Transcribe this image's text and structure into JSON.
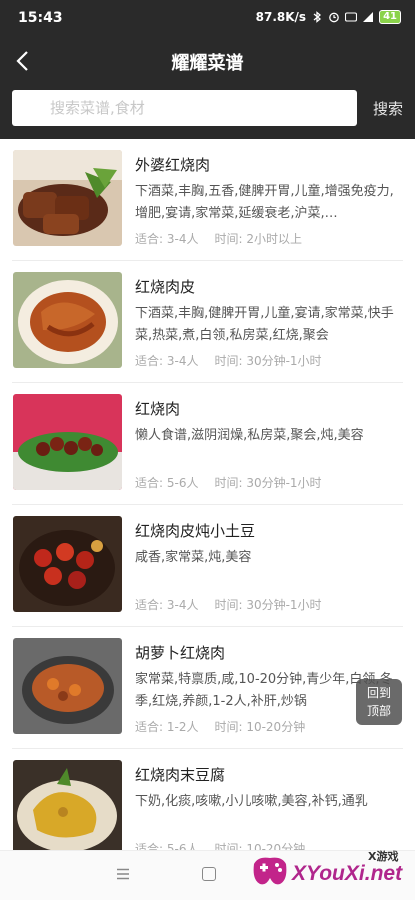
{
  "status_bar": {
    "time": "15:43",
    "network_speed": "87.8K/s",
    "battery": "41"
  },
  "header": {
    "title": "耀耀菜谱",
    "back_icon": "chevron-left-icon"
  },
  "search": {
    "placeholder": "搜索菜谱,食材",
    "button_label": "搜索"
  },
  "recipes": [
    {
      "name": "外婆红烧肉",
      "tags": "下酒菜,丰胸,五香,健脾开胃,儿童,增强免疫力,增肥,宴请,家常菜,延缓衰老,沪菜,…",
      "serves": "适合: 3-4人",
      "time": "时间: 2小时以上"
    },
    {
      "name": "红烧肉皮",
      "tags": "下酒菜,丰胸,健脾开胃,儿童,宴请,家常菜,快手菜,热菜,煮,白领,私房菜,红烧,聚会",
      "serves": "适合: 3-4人",
      "time": "时间: 30分钟-1小时"
    },
    {
      "name": "红烧肉",
      "tags": "懒人食谱,滋阴润燥,私房菜,聚会,炖,美容",
      "serves": "适合: 5-6人",
      "time": "时间: 30分钟-1小时"
    },
    {
      "name": "红烧肉皮炖小土豆",
      "tags": "咸香,家常菜,炖,美容",
      "serves": "适合: 3-4人",
      "time": "时间: 30分钟-1小时"
    },
    {
      "name": "胡萝卜红烧肉",
      "tags": "家常菜,特禀质,咸,10-20分钟,青少年,白领,冬季,红烧,养颜,1-2人,补肝,炒锅",
      "serves": "适合: 1-2人",
      "time": "时间: 10-20分钟"
    },
    {
      "name": "红烧肉末豆腐",
      "tags": "下奶,化痰,咳嗽,小儿咳嗽,美容,补钙,通乳",
      "serves": "适合: 5-6人",
      "time": "时间: 10-20分钟"
    }
  ],
  "back_to_top": {
    "line1": "回到",
    "line2": "顶部"
  },
  "watermark": {
    "en": "XYouXi.net",
    "cn": "X游戏"
  },
  "colors": {
    "header_bg": "#2a2a2a",
    "text_primary": "#222222",
    "text_secondary": "#555555",
    "meta_text": "#aaaaaa"
  }
}
